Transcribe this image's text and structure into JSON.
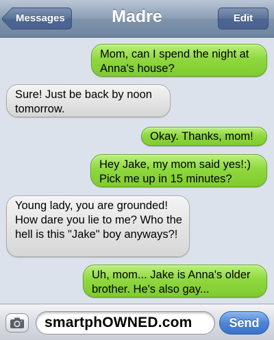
{
  "header": {
    "back_label": "Messages",
    "title": "Madre",
    "edit_label": "Edit"
  },
  "messages": [
    {
      "direction": "sent",
      "text": "Mom, can I spend the night at Anna's house?"
    },
    {
      "direction": "received",
      "text": "Sure! Just be back by noon tomorrow."
    },
    {
      "direction": "sent",
      "text": "Okay. Thanks, mom!"
    },
    {
      "direction": "sent",
      "text": "Hey Jake, my mom said yes!:) Pick me up in 15 minutes?"
    },
    {
      "direction": "received",
      "text": "Young lady, you are grounded! How dare you lie to me? Who the hell is this \"Jake\" boy anyways?!"
    },
    {
      "direction": "sent",
      "text": "Uh, mom... Jake is Anna's older brother. He's also gay..."
    }
  ],
  "composer": {
    "input_value": "smartphOWNED.com",
    "send_label": "Send",
    "camera_icon": "camera-icon"
  },
  "colors": {
    "sent_bubble": "#8fd83f",
    "received_bubble": "#e3e3e3",
    "nav_bar": "#8d9fb5",
    "send_button": "#4f85d6"
  }
}
